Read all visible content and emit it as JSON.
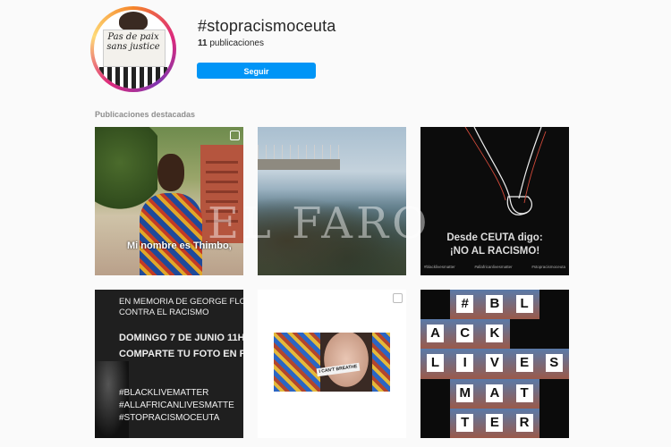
{
  "header": {
    "avatar_sign": "Pas de paix sans justice",
    "hashtag": "#stopracismoceuta",
    "post_count": "11",
    "post_count_label": "publicaciones",
    "follow_label": "Seguir"
  },
  "section": {
    "label": "Publicaciones destacadas"
  },
  "posts": [
    {
      "caption": "Mi nombre es Thimbo,"
    },
    {
      "caption": ""
    },
    {
      "title_line1": "Desde CEUTA digo:",
      "title_line2": "¡NO AL RACISMO!",
      "footer": [
        "#blacklivesmatter",
        "#allafricanlivesmatter",
        "#stopracismoceuta"
      ]
    },
    {
      "lines": [
        "EN MEMORIA DE GEORGE FLOYD, LAS VÍ",
        "CONTRA EL RACISMO",
        "DOMINGO 7 DE JUNIO 11H",
        "COMPARTE TU FOTO EN REDES",
        "#BLACKLIVEMATTER",
        "#ALLAFRICANLIVESMATTE",
        "#STOPRACISMOCEUTA"
      ]
    },
    {
      "tape": "I CAN'T BREATHE"
    },
    {
      "letters": [
        "#",
        "B",
        "L",
        "A",
        "C",
        "K",
        "L",
        "I",
        "V",
        "E",
        "S",
        "M",
        "A",
        "T",
        "T",
        "E",
        "R"
      ]
    }
  ],
  "watermark": "EL FARO"
}
